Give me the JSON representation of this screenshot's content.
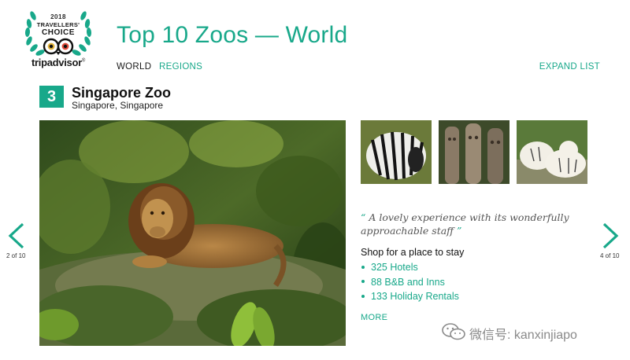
{
  "badge": {
    "year": "2018",
    "line1": "TRAVELLERS'",
    "line2": "CHOICE",
    "brand": "tripadvisor",
    "trademark": "®",
    "laurel_color": "#18a88a"
  },
  "header": {
    "title": "Top 10 Zoos — World",
    "tabs": [
      {
        "label": "WORLD",
        "active": true
      },
      {
        "label": "REGIONS",
        "active": false
      }
    ],
    "expand_label": "EXPAND LIST"
  },
  "attraction": {
    "rank": "3",
    "name": "Singapore Zoo",
    "location": "Singapore, Singapore",
    "photo": "lion-resting-on-rock",
    "thumbnails": [
      "zebra",
      "wooden-totem-carvings",
      "white-tigers"
    ],
    "quote_open": "“",
    "quote_text": "A lovely experience with its wonderfully approachable staff",
    "quote_close": "”",
    "shop_heading": "Shop for a place to stay",
    "stays": [
      "325 Hotels",
      "88 B&B and Inns",
      "133 Holiday Rentals"
    ],
    "more_label": "MORE"
  },
  "pagination": {
    "prev_label": "2 of 10",
    "next_label": "4 of 10",
    "prev_icon": "chevron-left-icon",
    "next_icon": "chevron-right-icon"
  },
  "watermark": {
    "icon": "wechat-icon",
    "text": "微信号: kanxinjiapo"
  },
  "colors": {
    "accent": "#18a88a",
    "text": "#1a1a1a",
    "quote": "#555555"
  }
}
